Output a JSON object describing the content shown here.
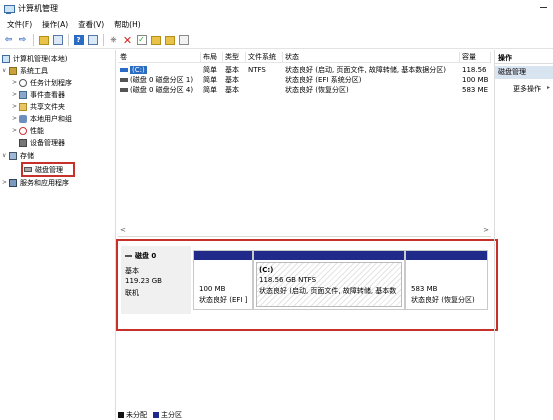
{
  "window": {
    "title": "计算机管理"
  },
  "menu": [
    "文件(F)",
    "操作(A)",
    "查看(V)",
    "帮助(H)"
  ],
  "tree": {
    "root": "计算机管理(本地)",
    "system_tools": "系统工具",
    "task_scheduler": "任务计划程序",
    "event_viewer": "事件查看器",
    "shared_folders": "共享文件夹",
    "local_users": "本地用户和组",
    "performance": "性能",
    "device_manager": "设备管理器",
    "storage": "存储",
    "disk_management": "磁盘管理",
    "services": "服务和应用程序"
  },
  "volume_columns": [
    "卷",
    "布局",
    "类型",
    "文件系统",
    "状态",
    "容量"
  ],
  "volumes": [
    {
      "name": "(C:)",
      "layout": "简单",
      "type": "基本",
      "fs": "NTFS",
      "status": "状态良好 (启动, 页面文件, 故障转储, 基本数据分区)",
      "capacity": "118.56"
    },
    {
      "name": "(磁盘 0 磁盘分区 1)",
      "layout": "简单",
      "type": "基本",
      "fs": "",
      "status": "状态良好 (EFI 系统分区)",
      "capacity": "100 MB"
    },
    {
      "name": "(磁盘 0 磁盘分区 4)",
      "layout": "简单",
      "type": "基本",
      "fs": "",
      "status": "状态良好 (恢复分区)",
      "capacity": "583 ME"
    }
  ],
  "scroll": {
    "left": "<",
    "right": ">"
  },
  "disk": {
    "name": "磁盘 0",
    "type": "基本",
    "size": "119.23 GB",
    "status": "联机",
    "partitions": [
      {
        "name": "",
        "size": "100 MB",
        "status": "状态良好 (EFI ]"
      },
      {
        "name": "(C:)",
        "size": "118.56 GB NTFS",
        "status": "状态良好 (启动, 页面文件, 故障转储, 基本数"
      },
      {
        "name": "",
        "size": "583 MB",
        "status": "状态良好 (恢复分区)"
      }
    ]
  },
  "legend": {
    "unallocated": "未分配",
    "primary": "主分区"
  },
  "actions": {
    "header": "操作",
    "selected": "磁盘管理",
    "more": "更多操作"
  },
  "colors": {
    "partition_bar": "#1f2a8a",
    "highlight": "#c8312a",
    "selection": "#2a6bc4"
  }
}
